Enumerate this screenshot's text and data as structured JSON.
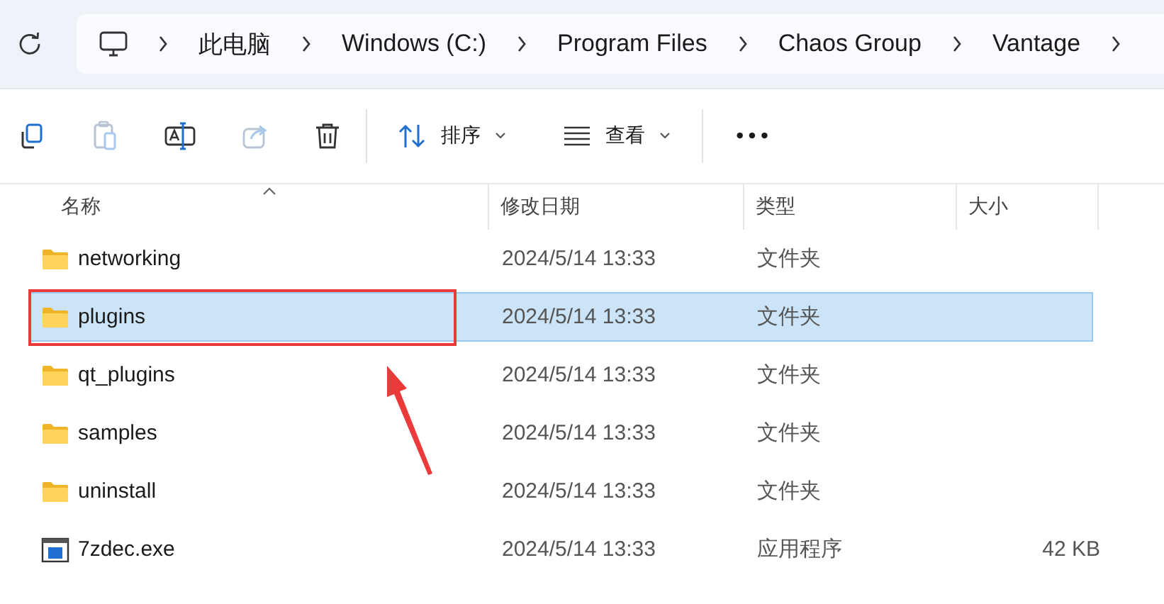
{
  "breadcrumb": [
    "此电脑",
    "Windows (C:)",
    "Program Files",
    "Chaos Group",
    "Vantage"
  ],
  "toolbar": {
    "sort": "排序",
    "view": "查看",
    "more": "•••"
  },
  "columns": [
    "名称",
    "修改日期",
    "类型",
    "大小"
  ],
  "rows": [
    {
      "kind": "folder",
      "name": "networking",
      "date": "2024/5/14 13:33",
      "type": "文件夹",
      "size": "",
      "selected": false,
      "annotated": false
    },
    {
      "kind": "folder",
      "name": "plugins",
      "date": "2024/5/14 13:33",
      "type": "文件夹",
      "size": "",
      "selected": true,
      "annotated": true
    },
    {
      "kind": "folder",
      "name": "qt_plugins",
      "date": "2024/5/14 13:33",
      "type": "文件夹",
      "size": "",
      "selected": false,
      "annotated": false
    },
    {
      "kind": "folder",
      "name": "samples",
      "date": "2024/5/14 13:33",
      "type": "文件夹",
      "size": "",
      "selected": false,
      "annotated": false
    },
    {
      "kind": "folder",
      "name": "uninstall",
      "date": "2024/5/14 13:33",
      "type": "文件夹",
      "size": "",
      "selected": false,
      "annotated": false
    },
    {
      "kind": "app",
      "name": "7zdec.exe",
      "date": "2024/5/14 13:33",
      "type": "应用程序",
      "size": "42 KB",
      "selected": false,
      "annotated": false
    }
  ]
}
